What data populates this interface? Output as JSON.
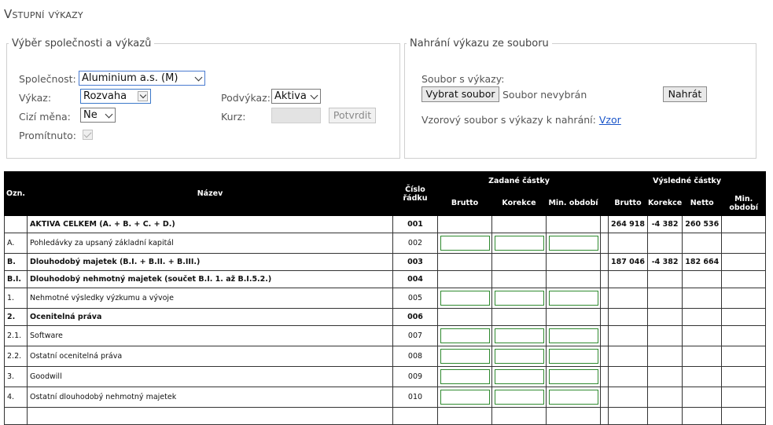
{
  "page": {
    "title": "Vstupní výkazy"
  },
  "selection": {
    "legend": "Výběr společnosti a výkazů",
    "company_label": "Společnost:",
    "company_value": "Aluminium a.s. (M)",
    "report_label": "Výkaz:",
    "report_value": "Rozvaha",
    "subreport_label": "Podvýkaz:",
    "subreport_value": "Aktiva",
    "currency_label": "Cizí měna:",
    "currency_value": "Ne",
    "rate_label": "Kurz:",
    "confirm_label": "Potvrdit",
    "propagated_label": "Promítnuto:"
  },
  "upload": {
    "legend": "Nahrání výkazu ze souboru",
    "file_label": "Soubor s výkazy:",
    "choose_label": "Vybrat soubor",
    "no_file_text": "Soubor nevybrán",
    "upload_label": "Nahrát",
    "sample_text": "Vzorový soubor s výkazy k nahrání:",
    "sample_link": "Vzor"
  },
  "table": {
    "headers": {
      "code": "Ozn.",
      "name": "Název",
      "row_no_1": "Číslo",
      "row_no_2": "řádku",
      "entered": "Zadané částky",
      "result": "Výsledné částky",
      "brutto": "Brutto",
      "korekce": "Korekce",
      "min_obdobi": "Min. období",
      "netto": "Netto",
      "min_obdobi_1": "Min.",
      "min_obdobi_2": "období"
    },
    "rows": [
      {
        "code": "",
        "name": "AKTIVA CELKEM (A. + B. + C. + D.)",
        "row": "001",
        "bold": true,
        "inputs": false,
        "brutto": "264 918",
        "korekce": "-4 382",
        "netto": "260 536",
        "min": ""
      },
      {
        "code": "A.",
        "name": "Pohledávky za upsaný základní kapitál",
        "row": "002",
        "bold": false,
        "inputs": true,
        "brutto": "",
        "korekce": "",
        "netto": "",
        "min": ""
      },
      {
        "code": "B.",
        "name": "Dlouhodobý majetek (B.I. + B.II. + B.III.)",
        "row": "003",
        "bold": true,
        "inputs": false,
        "brutto": "187 046",
        "korekce": "-4 382",
        "netto": "182 664",
        "min": ""
      },
      {
        "code": "B.I.",
        "name": "Dlouhodobý nehmotný majetek (součet B.I. 1. až B.I.5.2.)",
        "row": "004",
        "bold": true,
        "inputs": false,
        "brutto": "",
        "korekce": "",
        "netto": "",
        "min": ""
      },
      {
        "code": "1.",
        "name": "Nehmotné výsledky výzkumu a vývoje",
        "row": "005",
        "bold": false,
        "inputs": true,
        "brutto": "",
        "korekce": "",
        "netto": "",
        "min": ""
      },
      {
        "code": "2.",
        "name": "Ocenitelná práva",
        "row": "006",
        "bold": true,
        "inputs": false,
        "brutto": "",
        "korekce": "",
        "netto": "",
        "min": ""
      },
      {
        "code": "2.1.",
        "name": "Software",
        "row": "007",
        "bold": false,
        "inputs": true,
        "brutto": "",
        "korekce": "",
        "netto": "",
        "min": ""
      },
      {
        "code": "2.2.",
        "name": "Ostatní ocenitelná práva",
        "row": "008",
        "bold": false,
        "inputs": true,
        "brutto": "",
        "korekce": "",
        "netto": "",
        "min": ""
      },
      {
        "code": "3.",
        "name": "Goodwill",
        "row": "009",
        "bold": false,
        "inputs": true,
        "brutto": "",
        "korekce": "",
        "netto": "",
        "min": ""
      },
      {
        "code": "4.",
        "name": "Ostatní dlouhodobý nehmotný majetek",
        "row": "010",
        "bold": false,
        "inputs": true,
        "brutto": "",
        "korekce": "",
        "netto": "",
        "min": ""
      }
    ]
  }
}
